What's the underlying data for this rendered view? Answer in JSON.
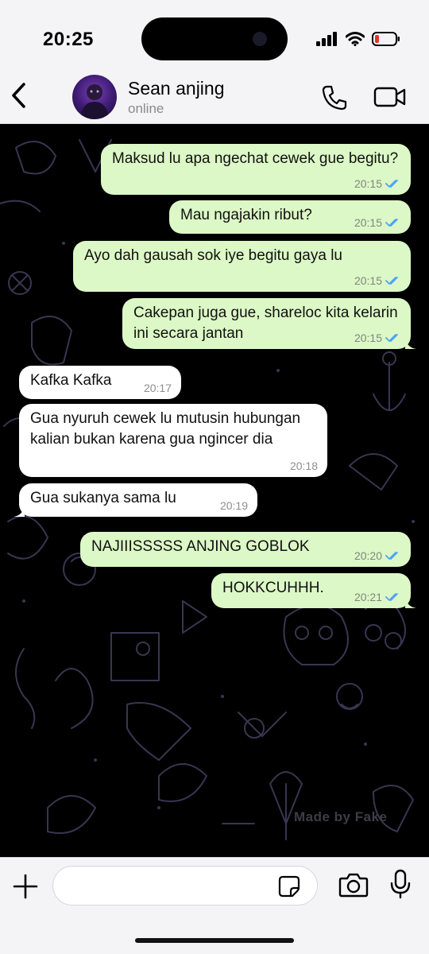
{
  "status_bar": {
    "time": "20:25"
  },
  "header": {
    "contact_name": "Sean anjing",
    "contact_status": "online"
  },
  "messages": [
    {
      "direction": "outgoing",
      "text": "Maksud lu apa ngechat cewek gue begitu?",
      "time": "20:15",
      "read": true
    },
    {
      "direction": "outgoing",
      "text": "Mau ngajakin ribut?",
      "time": "20:15",
      "read": true
    },
    {
      "direction": "outgoing",
      "text": "Ayo dah gausah sok iye begitu gaya lu",
      "time": "20:15",
      "read": true
    },
    {
      "direction": "outgoing",
      "text": "Cakepan juga gue, shareloc kita kelarin ini secara jantan",
      "time": "20:15",
      "read": true
    },
    {
      "direction": "incoming",
      "text": "Kafka Kafka",
      "time": "20:17"
    },
    {
      "direction": "incoming",
      "text": "Gua nyuruh cewek lu mutusin hubungan kalian bukan karena gua ngincer dia",
      "time": "20:18"
    },
    {
      "direction": "incoming",
      "text": "Gua sukanya sama lu",
      "time": "20:19"
    },
    {
      "direction": "outgoing",
      "text": "NAJIIISSSSS ANJING GOBLOK",
      "time": "20:20",
      "read": true
    },
    {
      "direction": "outgoing",
      "text": "HOKKCUHHH.",
      "time": "20:21",
      "read": true
    }
  ],
  "watermark": "Made by Fake",
  "input": {
    "value": "",
    "placeholder": ""
  },
  "colors": {
    "outgoing_bubble": "#dcf8c6",
    "incoming_bubble": "#ffffff",
    "read_tick": "#4fa3f7",
    "chat_background": "#000000",
    "doodle_stroke": "#3a3550"
  },
  "icons": [
    "back-chevron-icon",
    "phone-icon",
    "video-camera-icon",
    "plus-icon",
    "sticker-icon",
    "camera-icon",
    "microphone-icon",
    "double-check-icon",
    "signal-icon",
    "wifi-icon",
    "battery-icon"
  ]
}
